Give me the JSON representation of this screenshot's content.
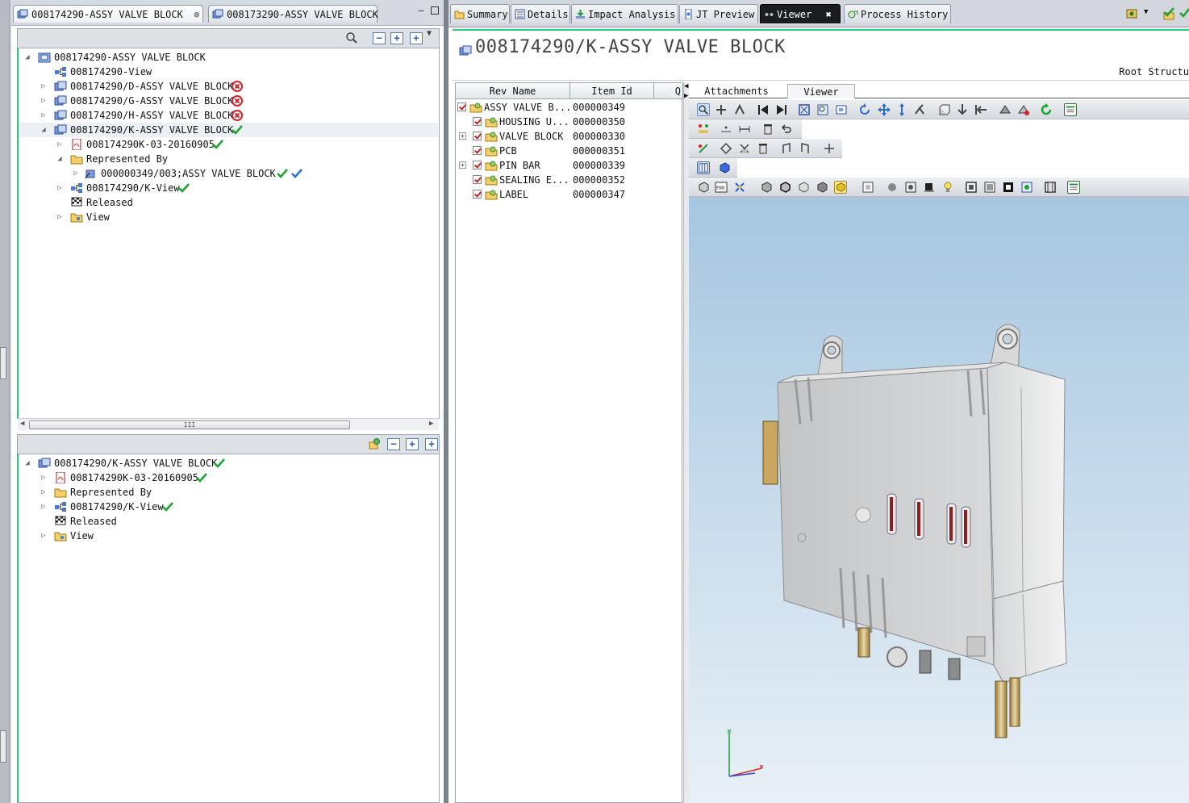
{
  "left_panel": {
    "tabs": [
      {
        "label": "008174290-ASSY VALVE BLOCK",
        "close": "⊗"
      },
      {
        "label": "008173290-ASSY VALVE BLOCK"
      }
    ],
    "top_tree": [
      {
        "label": "008174290-ASSY VALVE BLOCK",
        "status": ""
      },
      {
        "label": "008174290-View",
        "status": ""
      },
      {
        "label": "008174290/D-ASSY VALVE BLOCK",
        "status": "rejected"
      },
      {
        "label": "008174290/G-ASSY VALVE BLOCK",
        "status": "rejected"
      },
      {
        "label": "008174290/H-ASSY VALVE BLOCK",
        "status": "rejected"
      },
      {
        "label": "008174290/K-ASSY VALVE BLOCK",
        "status": "approved"
      },
      {
        "label": "008174290K-03-20160905",
        "status": "approved"
      },
      {
        "label": "Represented By",
        "status": ""
      },
      {
        "label": "000000349/003;ASSY VALVE BLOCK",
        "status": "approved"
      },
      {
        "label": "008174290/K-View",
        "status": "approved"
      },
      {
        "label": "Released",
        "status": ""
      },
      {
        "label": "View",
        "status": ""
      }
    ],
    "bottom_tree": [
      {
        "label": "008174290/K-ASSY VALVE BLOCK",
        "status": "approved"
      },
      {
        "label": "008174290K-03-20160905",
        "status": "approved"
      },
      {
        "label": "Represented By",
        "status": ""
      },
      {
        "label": "008174290/K-View",
        "status": "approved"
      },
      {
        "label": "Released",
        "status": ""
      },
      {
        "label": "View",
        "status": ""
      }
    ],
    "scroll_grip": "III"
  },
  "right_panel": {
    "tabs": [
      {
        "label": "Summary"
      },
      {
        "label": "Details"
      },
      {
        "label": "Impact Analysis"
      },
      {
        "label": "JT Preview"
      },
      {
        "label": "Viewer",
        "close": "✖"
      },
      {
        "label": "Process History"
      }
    ],
    "title": "008174290/K-ASSY VALVE BLOCK",
    "root_structure": "Root Structu",
    "bom": {
      "columns": [
        "Rev Name",
        "Item Id",
        "Q"
      ],
      "rows": [
        {
          "name": "ASSY VALVE B...",
          "id": "000000349"
        },
        {
          "name": "HOUSING U...",
          "id": "000000350"
        },
        {
          "name": "VALVE BLOCK",
          "id": "000000330"
        },
        {
          "name": "PCB",
          "id": "000000351"
        },
        {
          "name": "PIN BAR",
          "id": "000000339"
        },
        {
          "name": "SEALING E...",
          "id": "000000352"
        },
        {
          "name": "LABEL",
          "id": "000000347"
        }
      ]
    },
    "viewer_tabs": [
      "Attachments",
      "Viewer"
    ]
  },
  "colors": {
    "accent_green": "#22bb66",
    "status_red": "#d8202a",
    "status_green": "#1aa52e",
    "status_blue": "#2a6fd6",
    "viewer_sky": "#a6c6e0"
  }
}
